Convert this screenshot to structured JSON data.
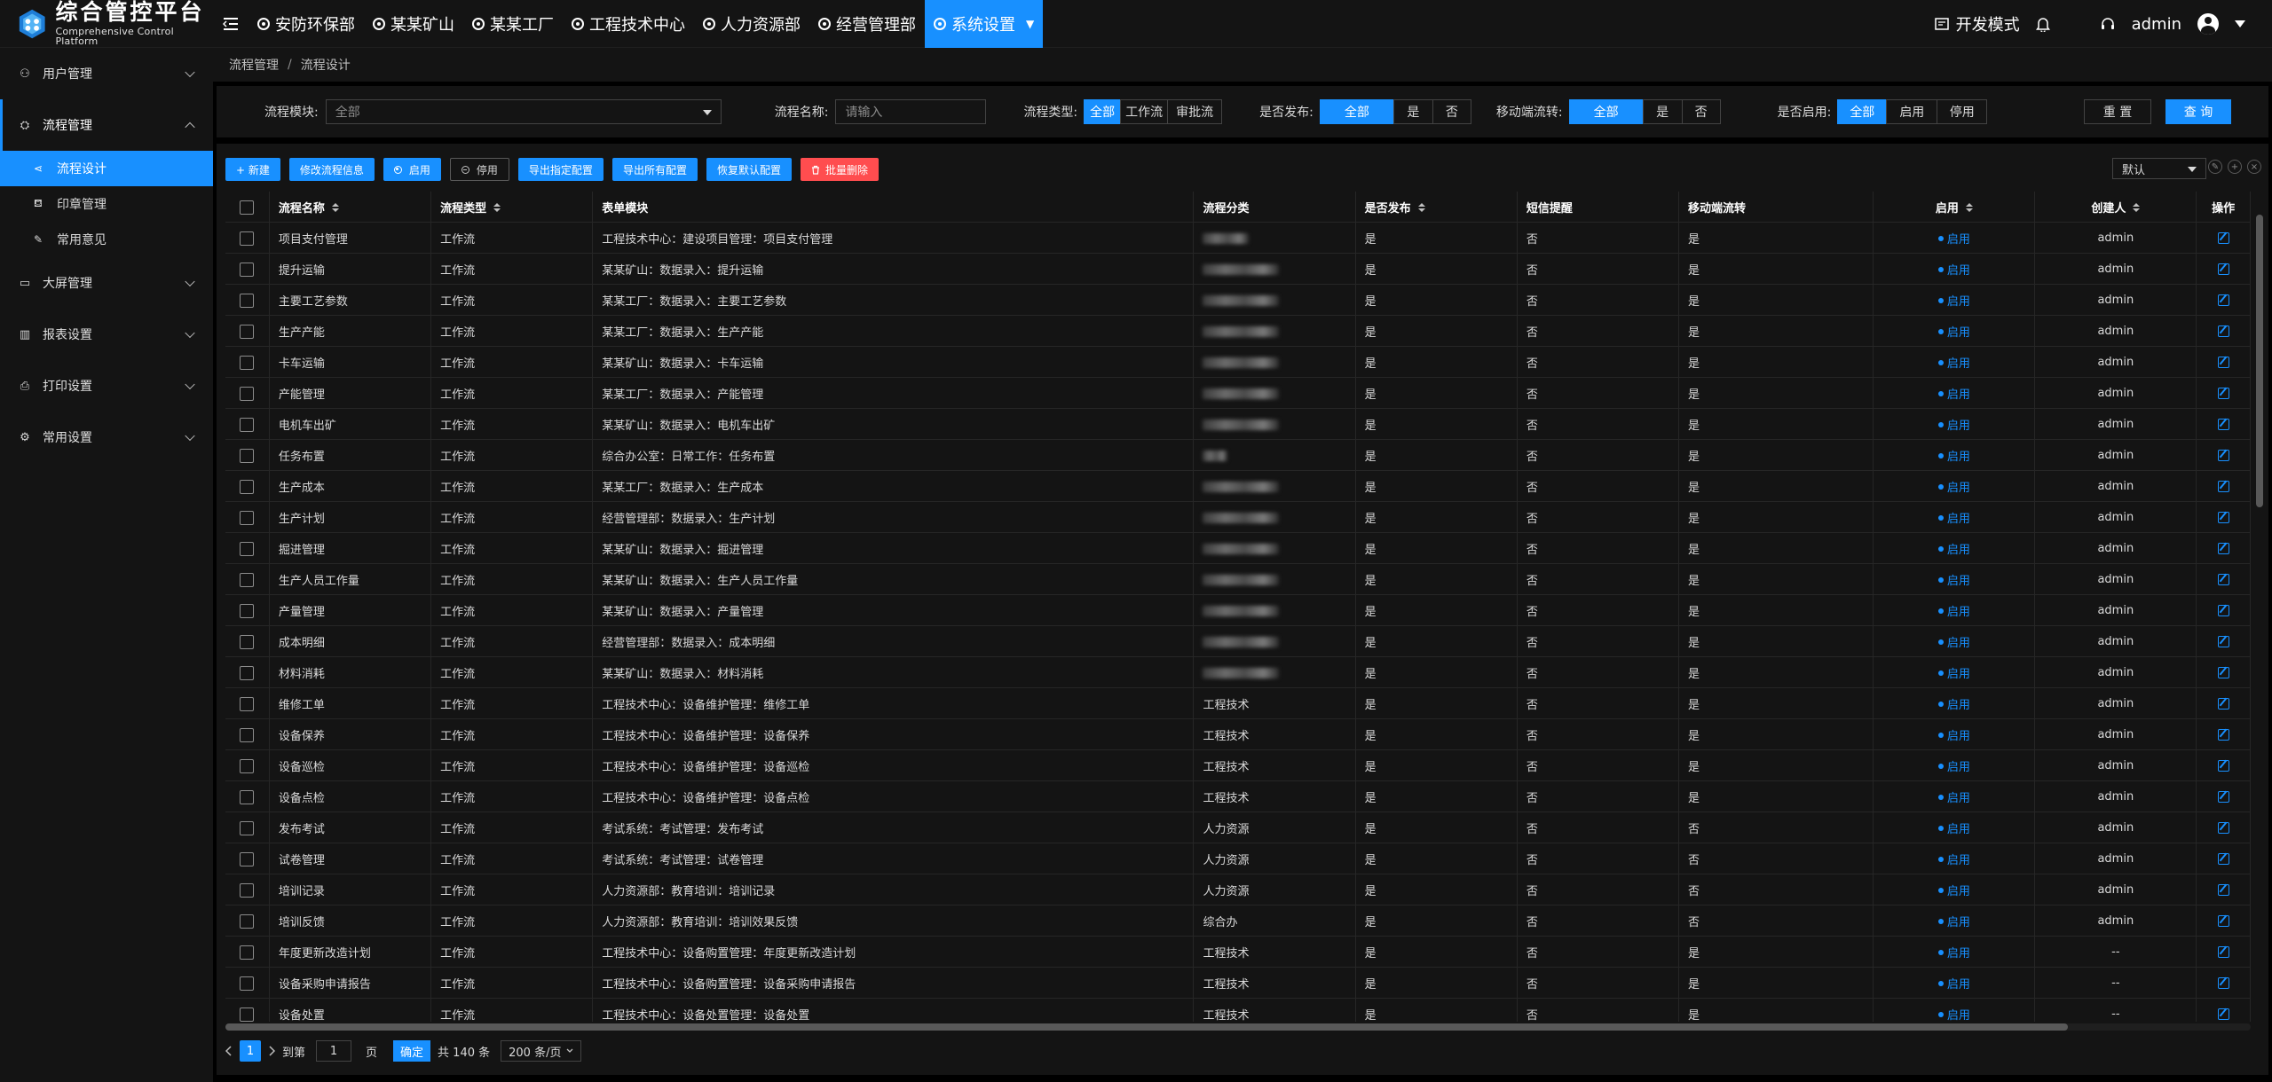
{
  "app": {
    "title_cn": "综合管控平台",
    "title_en": "Comprehensive Control Platform"
  },
  "topnav": [
    {
      "label": "安防环保部",
      "active": false
    },
    {
      "label": "某某矿山",
      "active": false
    },
    {
      "label": "某某工厂",
      "active": false
    },
    {
      "label": "工程技术中心",
      "active": false
    },
    {
      "label": "人力资源部",
      "active": false
    },
    {
      "label": "经营管理部",
      "active": false
    },
    {
      "label": "系统设置",
      "active": true
    }
  ],
  "topright": {
    "dev_mode": "开发模式",
    "user": "admin"
  },
  "sidebar": {
    "menus": [
      {
        "label": "用户管理",
        "icon": "users-icon",
        "open": false,
        "children": []
      },
      {
        "label": "流程管理",
        "icon": "flow-icon",
        "open": true,
        "children": [
          {
            "label": "流程设计",
            "icon": "share-icon",
            "active": true
          },
          {
            "label": "印章管理",
            "icon": "stamp-icon",
            "active": false
          },
          {
            "label": "常用意见",
            "icon": "pen-icon",
            "active": false
          }
        ]
      },
      {
        "label": "大屏管理",
        "icon": "screen-icon",
        "open": false,
        "children": []
      },
      {
        "label": "报表设置",
        "icon": "report-icon",
        "open": false,
        "children": []
      },
      {
        "label": "打印设置",
        "icon": "printer-icon",
        "open": false,
        "children": []
      },
      {
        "label": "常用设置",
        "icon": "gear-icon",
        "open": false,
        "children": []
      }
    ]
  },
  "breadcrumb": [
    "流程管理",
    "流程设计"
  ],
  "filter": {
    "module_label": "流程模块:",
    "module_value": "全部",
    "name_label": "流程名称:",
    "name_placeholder": "请输入",
    "type_label": "流程类型:",
    "type_options": [
      "全部",
      "工作流",
      "审批流"
    ],
    "publish_label": "是否发布:",
    "publish_options": [
      "全部",
      "是",
      "否"
    ],
    "mobile_label": "移动端流转:",
    "mobile_options": [
      "全部",
      "是",
      "否"
    ],
    "enable_label": "是否启用:",
    "enable_options": [
      "全部",
      "启用",
      "停用"
    ],
    "reset": "重 置",
    "query": "查 询"
  },
  "toolbar": {
    "new": "+ 新建",
    "edit_info": "修改流程信息",
    "enable": "启用",
    "disable": "停用",
    "export_selected": "导出指定配置",
    "export_all": "导出所有配置",
    "restore_default": "恢复默认配置",
    "batch_delete": "批量删除",
    "view": "默认"
  },
  "table": {
    "columns": [
      "流程名称",
      "流程类型",
      "表单模块",
      "流程分类",
      "是否发布",
      "短信提醒",
      "移动端流转",
      "启用",
      "创建人",
      "操作"
    ],
    "rows": [
      {
        "name": "项目支付管理",
        "type": "工作流",
        "module": "工程技术中心：建设项目管理：项目支付管理",
        "category": "",
        "publish": "是",
        "sms": "否",
        "mobile": "是",
        "enable": "启用",
        "creator": "admin"
      },
      {
        "name": "提升运输",
        "type": "工作流",
        "module": "某某矿山：数据录入：提升运输",
        "category": "",
        "publish": "是",
        "sms": "否",
        "mobile": "是",
        "enable": "启用",
        "creator": "admin"
      },
      {
        "name": "主要工艺参数",
        "type": "工作流",
        "module": "某某工厂：数据录入：主要工艺参数",
        "category": "",
        "publish": "是",
        "sms": "否",
        "mobile": "是",
        "enable": "启用",
        "creator": "admin"
      },
      {
        "name": "生产产能",
        "type": "工作流",
        "module": "某某工厂：数据录入：生产产能",
        "category": "",
        "publish": "是",
        "sms": "否",
        "mobile": "是",
        "enable": "启用",
        "creator": "admin"
      },
      {
        "name": "卡车运输",
        "type": "工作流",
        "module": "某某矿山：数据录入：卡车运输",
        "category": "",
        "publish": "是",
        "sms": "否",
        "mobile": "是",
        "enable": "启用",
        "creator": "admin"
      },
      {
        "name": "产能管理",
        "type": "工作流",
        "module": "某某工厂：数据录入：产能管理",
        "category": "",
        "publish": "是",
        "sms": "否",
        "mobile": "是",
        "enable": "启用",
        "creator": "admin"
      },
      {
        "name": "电机车出矿",
        "type": "工作流",
        "module": "某某矿山：数据录入：电机车出矿",
        "category": "",
        "publish": "是",
        "sms": "否",
        "mobile": "是",
        "enable": "启用",
        "creator": "admin"
      },
      {
        "name": "任务布置",
        "type": "工作流",
        "module": "综合办公室：日常工作：任务布置",
        "category": "",
        "publish": "是",
        "sms": "否",
        "mobile": "是",
        "enable": "启用",
        "creator": "admin"
      },
      {
        "name": "生产成本",
        "type": "工作流",
        "module": "某某工厂：数据录入：生产成本",
        "category": "",
        "publish": "是",
        "sms": "否",
        "mobile": "是",
        "enable": "启用",
        "creator": "admin"
      },
      {
        "name": "生产计划",
        "type": "工作流",
        "module": "经营管理部：数据录入：生产计划",
        "category": "",
        "publish": "是",
        "sms": "否",
        "mobile": "是",
        "enable": "启用",
        "creator": "admin"
      },
      {
        "name": "掘进管理",
        "type": "工作流",
        "module": "某某矿山：数据录入：掘进管理",
        "category": "",
        "publish": "是",
        "sms": "否",
        "mobile": "是",
        "enable": "启用",
        "creator": "admin"
      },
      {
        "name": "生产人员工作量",
        "type": "工作流",
        "module": "某某矿山：数据录入：生产人员工作量",
        "category": "",
        "publish": "是",
        "sms": "否",
        "mobile": "是",
        "enable": "启用",
        "creator": "admin"
      },
      {
        "name": "产量管理",
        "type": "工作流",
        "module": "某某矿山：数据录入：产量管理",
        "category": "",
        "publish": "是",
        "sms": "否",
        "mobile": "是",
        "enable": "启用",
        "creator": "admin"
      },
      {
        "name": "成本明细",
        "type": "工作流",
        "module": "经营管理部：数据录入：成本明细",
        "category": "",
        "publish": "是",
        "sms": "否",
        "mobile": "是",
        "enable": "启用",
        "creator": "admin"
      },
      {
        "name": "材料消耗",
        "type": "工作流",
        "module": "某某矿山：数据录入：材料消耗",
        "category": "",
        "publish": "是",
        "sms": "否",
        "mobile": "是",
        "enable": "启用",
        "creator": "admin"
      },
      {
        "name": "维修工单",
        "type": "工作流",
        "module": "工程技术中心：设备维护管理：维修工单",
        "category": "工程技术",
        "publish": "是",
        "sms": "否",
        "mobile": "是",
        "enable": "启用",
        "creator": "admin"
      },
      {
        "name": "设备保养",
        "type": "工作流",
        "module": "工程技术中心：设备维护管理：设备保养",
        "category": "工程技术",
        "publish": "是",
        "sms": "否",
        "mobile": "是",
        "enable": "启用",
        "creator": "admin"
      },
      {
        "name": "设备巡检",
        "type": "工作流",
        "module": "工程技术中心：设备维护管理：设备巡检",
        "category": "工程技术",
        "publish": "是",
        "sms": "否",
        "mobile": "是",
        "enable": "启用",
        "creator": "admin"
      },
      {
        "name": "设备点检",
        "type": "工作流",
        "module": "工程技术中心：设备维护管理：设备点检",
        "category": "工程技术",
        "publish": "是",
        "sms": "否",
        "mobile": "是",
        "enable": "启用",
        "creator": "admin"
      },
      {
        "name": "发布考试",
        "type": "工作流",
        "module": "考试系统：考试管理：发布考试",
        "category": "人力资源",
        "publish": "是",
        "sms": "否",
        "mobile": "否",
        "enable": "启用",
        "creator": "admin"
      },
      {
        "name": "试卷管理",
        "type": "工作流",
        "module": "考试系统：考试管理：试卷管理",
        "category": "人力资源",
        "publish": "是",
        "sms": "否",
        "mobile": "否",
        "enable": "启用",
        "creator": "admin"
      },
      {
        "name": "培训记录",
        "type": "工作流",
        "module": "人力资源部：教育培训：培训记录",
        "category": "人力资源",
        "publish": "是",
        "sms": "否",
        "mobile": "否",
        "enable": "启用",
        "creator": "admin"
      },
      {
        "name": "培训反馈",
        "type": "工作流",
        "module": "人力资源部：教育培训：培训效果反馈",
        "category": "综合办",
        "publish": "是",
        "sms": "否",
        "mobile": "否",
        "enable": "启用",
        "creator": "admin"
      },
      {
        "name": "年度更新改造计划",
        "type": "工作流",
        "module": "工程技术中心：设备购置管理：年度更新改造计划",
        "category": "工程技术",
        "publish": "是",
        "sms": "否",
        "mobile": "是",
        "enable": "启用",
        "creator": "--"
      },
      {
        "name": "设备采购申请报告",
        "type": "工作流",
        "module": "工程技术中心：设备购置管理：设备采购申请报告",
        "category": "工程技术",
        "publish": "是",
        "sms": "否",
        "mobile": "是",
        "enable": "启用",
        "creator": "--"
      },
      {
        "name": "设备处置",
        "type": "工作流",
        "module": "工程技术中心：设备处置管理：设备处置",
        "category": "工程技术",
        "publish": "是",
        "sms": "否",
        "mobile": "是",
        "enable": "启用",
        "creator": "--"
      }
    ]
  },
  "pager": {
    "current": "1",
    "goto_label": "到第",
    "goto_value": "1",
    "page_unit": "页",
    "confirm": "确定",
    "total": "共 140 条",
    "page_size": "200 条/页"
  }
}
